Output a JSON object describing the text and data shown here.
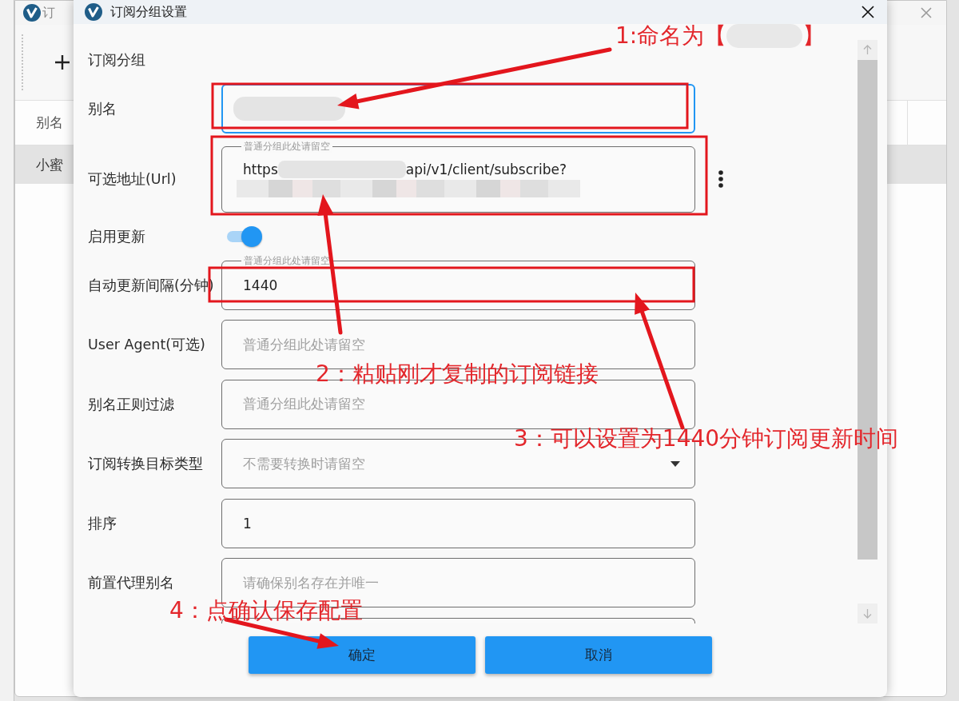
{
  "background_window": {
    "title": "订",
    "table": {
      "columns": [
        "别名"
      ],
      "rows": [
        {
          "cells": [
            "小蜜"
          ],
          "selected": true
        }
      ]
    }
  },
  "dialog": {
    "title": "订阅分组设置",
    "section_title": "订阅分组",
    "fields": [
      {
        "kind": "text",
        "label": "别名",
        "focused": true,
        "value": [
          [
            {
              "kind": "blur"
            }
          ]
        ]
      },
      {
        "kind": "text",
        "label": "可选地址(Url)",
        "floating_label": "普通分组此处请留空",
        "focused": false,
        "menu": true,
        "value": [
          [
            {
              "kind": "text",
              "text": "https"
            },
            {
              "kind": "blur"
            },
            {
              "kind": "text",
              "text": "api/v1/client/subscribe?"
            }
          ],
          [
            {
              "kind": "blur"
            }
          ]
        ]
      },
      {
        "kind": "toggle",
        "label": "启用更新",
        "on": true
      },
      {
        "kind": "text",
        "label": "自动更新间隔(分钟)",
        "floating_label": "普通分组此处请留空",
        "focused": false,
        "value": [
          [
            {
              "kind": "text",
              "text": "1440"
            }
          ]
        ]
      },
      {
        "kind": "text",
        "label": "User Agent(可选)",
        "focused": false,
        "placeholder": "普通分组此处请留空"
      },
      {
        "kind": "text",
        "label": "别名正则过滤",
        "focused": false,
        "placeholder": "普通分组此处请留空"
      },
      {
        "kind": "select",
        "label": "订阅转换目标类型",
        "placeholder": "不需要转换时请留空"
      },
      {
        "kind": "text",
        "label": "排序",
        "focused": false,
        "value": [
          [
            {
              "kind": "text",
              "text": "1"
            }
          ]
        ]
      },
      {
        "kind": "text",
        "label": "前置代理别名",
        "focused": false,
        "placeholder": "请确保别名存在并唯一"
      },
      {
        "kind": "partial"
      }
    ],
    "buttons": [
      "确定",
      "取消"
    ]
  },
  "annotations": [
    {
      "parts": [
        {
          "kind": "text",
          "text": "1:命名为【"
        },
        {
          "kind": "blur"
        },
        {
          "kind": "text",
          "text": "】"
        }
      ]
    },
    {
      "parts": [
        {
          "kind": "text",
          "text": "2：粘贴刚才复制的订阅链接"
        }
      ]
    },
    {
      "parts": [
        {
          "kind": "text",
          "text": "3：可以设置为1440分钟订阅更新时间"
        }
      ]
    },
    {
      "parts": [
        {
          "kind": "text",
          "text": "4：点确认保存配置"
        }
      ]
    }
  ]
}
